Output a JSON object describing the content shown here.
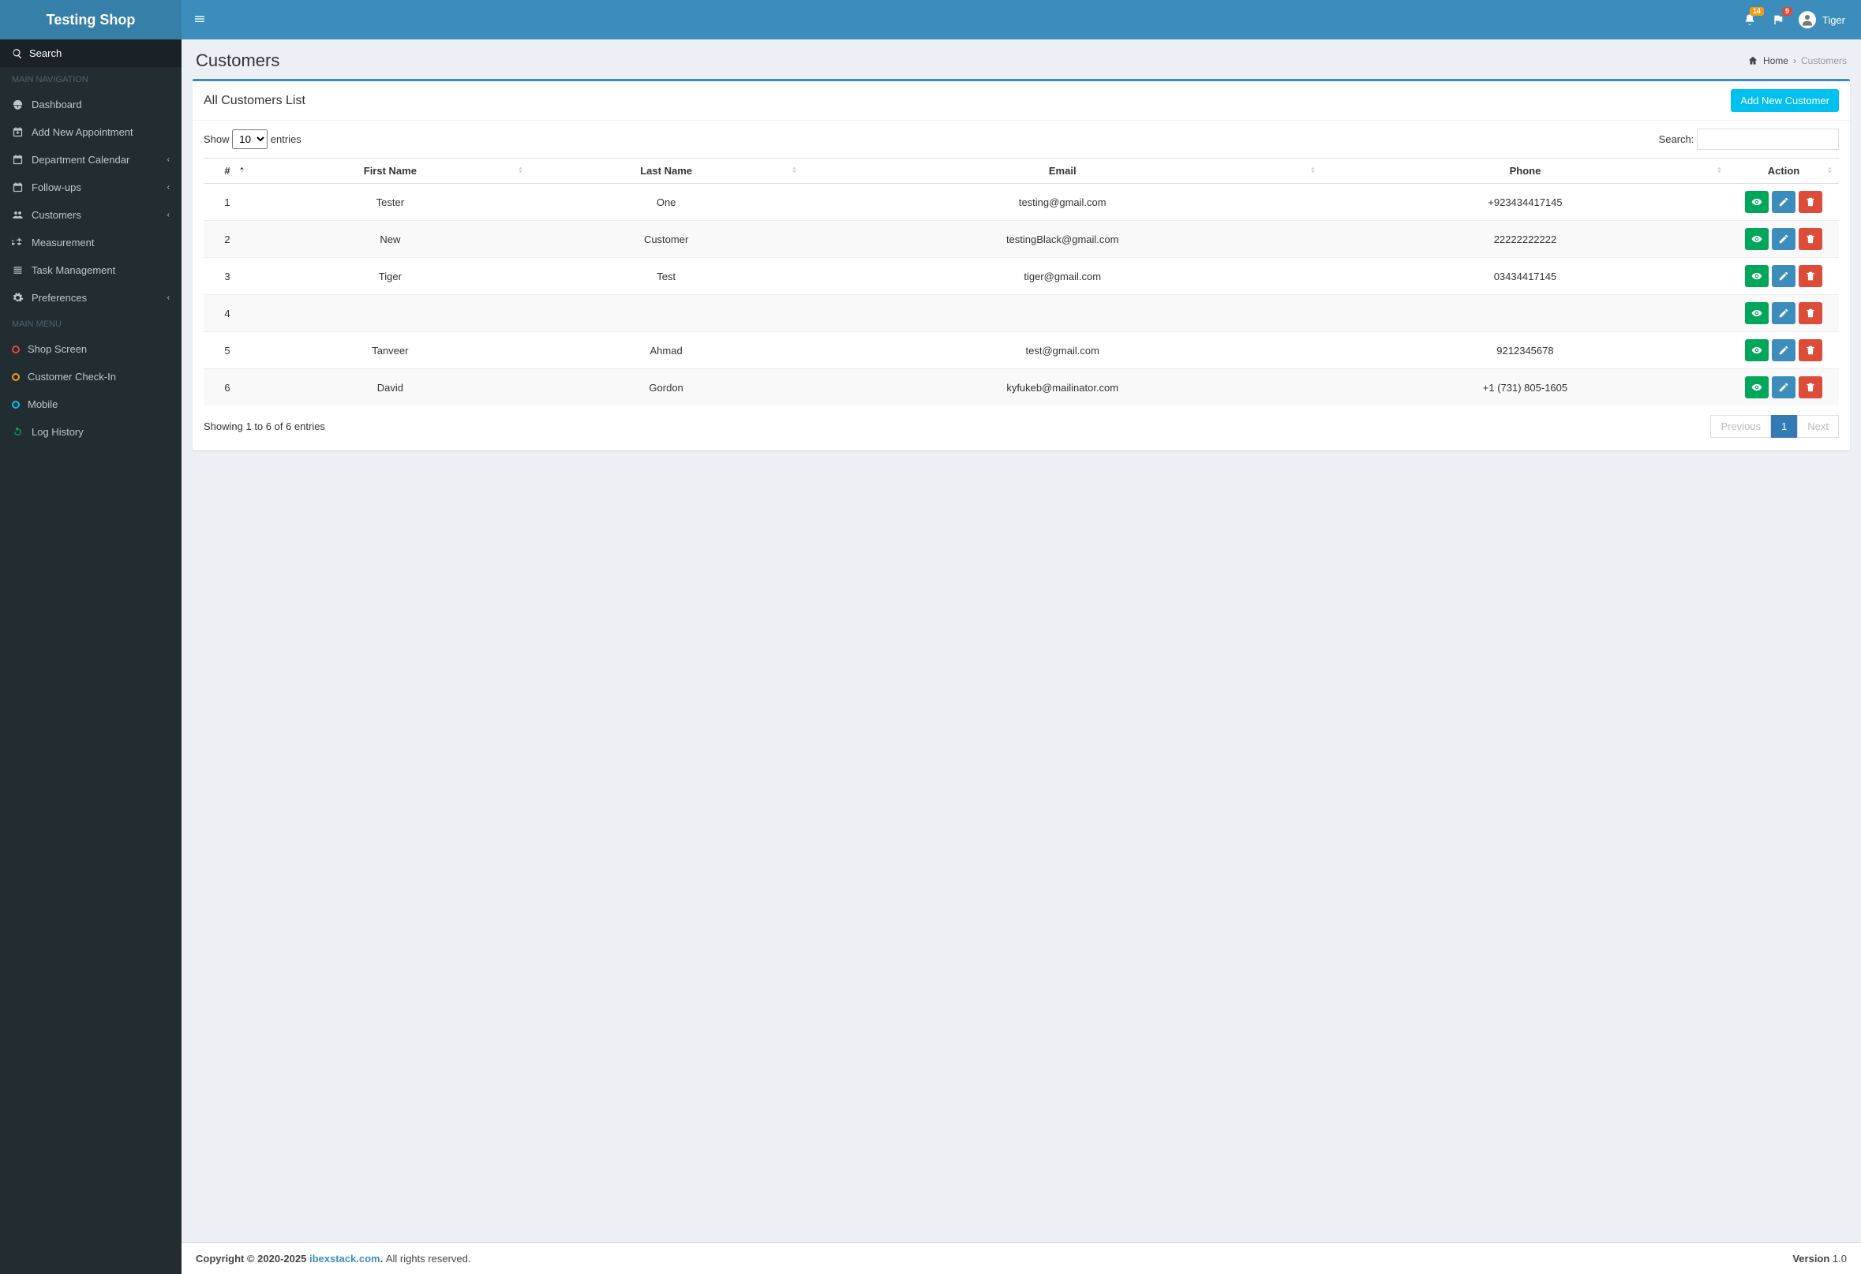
{
  "brand": "Testing Shop",
  "topnav": {
    "notifications_badge": "14",
    "messages_badge": "9",
    "username": "Tiger"
  },
  "sidebar": {
    "search_label": "Search",
    "header1": "MAIN NAVIGATION",
    "items": [
      {
        "label": "Dashboard"
      },
      {
        "label": "Add New Appointment"
      },
      {
        "label": "Department Calendar",
        "has_sub": true
      },
      {
        "label": "Follow-ups",
        "has_sub": true
      },
      {
        "label": "Customers",
        "has_sub": true
      },
      {
        "label": "Measurement"
      },
      {
        "label": "Task Management"
      },
      {
        "label": "Preferences",
        "has_sub": true
      }
    ],
    "header2": "MAIN MENU",
    "menu2": [
      {
        "label": "Shop Screen",
        "color": "#dd4b39"
      },
      {
        "label": "Customer Check-In",
        "color": "#f39c12"
      },
      {
        "label": "Mobile",
        "color": "#00c0ef"
      },
      {
        "label": "Log History",
        "color": "#00a65a",
        "icon": "refresh"
      }
    ]
  },
  "page": {
    "title": "Customers",
    "breadcrumb_home": "Home",
    "breadcrumb_current": "Customers",
    "box_title": "All Customers List",
    "add_button": "Add New Customer"
  },
  "datatable": {
    "show_label_pre": "Show",
    "show_label_post": "entries",
    "length_value": "10",
    "search_label": "Search:",
    "columns": [
      "#",
      "First Name",
      "Last Name",
      "Email",
      "Phone",
      "Action"
    ],
    "rows": [
      {
        "n": "1",
        "first": "Tester",
        "last": "One",
        "email": "testing@gmail.com",
        "phone": "+923434417145"
      },
      {
        "n": "2",
        "first": "New",
        "last": "Customer",
        "email": "testingBlack@gmail.com",
        "phone": "22222222222"
      },
      {
        "n": "3",
        "first": "Tiger",
        "last": "Test",
        "email": "tiger@gmail.com",
        "phone": "03434417145"
      },
      {
        "n": "4",
        "first": "",
        "last": "",
        "email": "",
        "phone": ""
      },
      {
        "n": "5",
        "first": "Tanveer",
        "last": "Ahmad",
        "email": "test@gmail.com",
        "phone": "9212345678"
      },
      {
        "n": "6",
        "first": "David",
        "last": "Gordon",
        "email": "kyfukeb@mailinator.com",
        "phone": "+1 (731) 805-1605"
      }
    ],
    "info": "Showing 1 to 6 of 6 entries",
    "pagination": {
      "prev": "Previous",
      "page": "1",
      "next": "Next"
    }
  },
  "footer": {
    "copyright_strong": "Copyright © 2020-2025",
    "link_text": "ibexstack.com",
    "rights": " All rights reserved.",
    "version_label": "Version",
    "version_num": " 1.0"
  }
}
